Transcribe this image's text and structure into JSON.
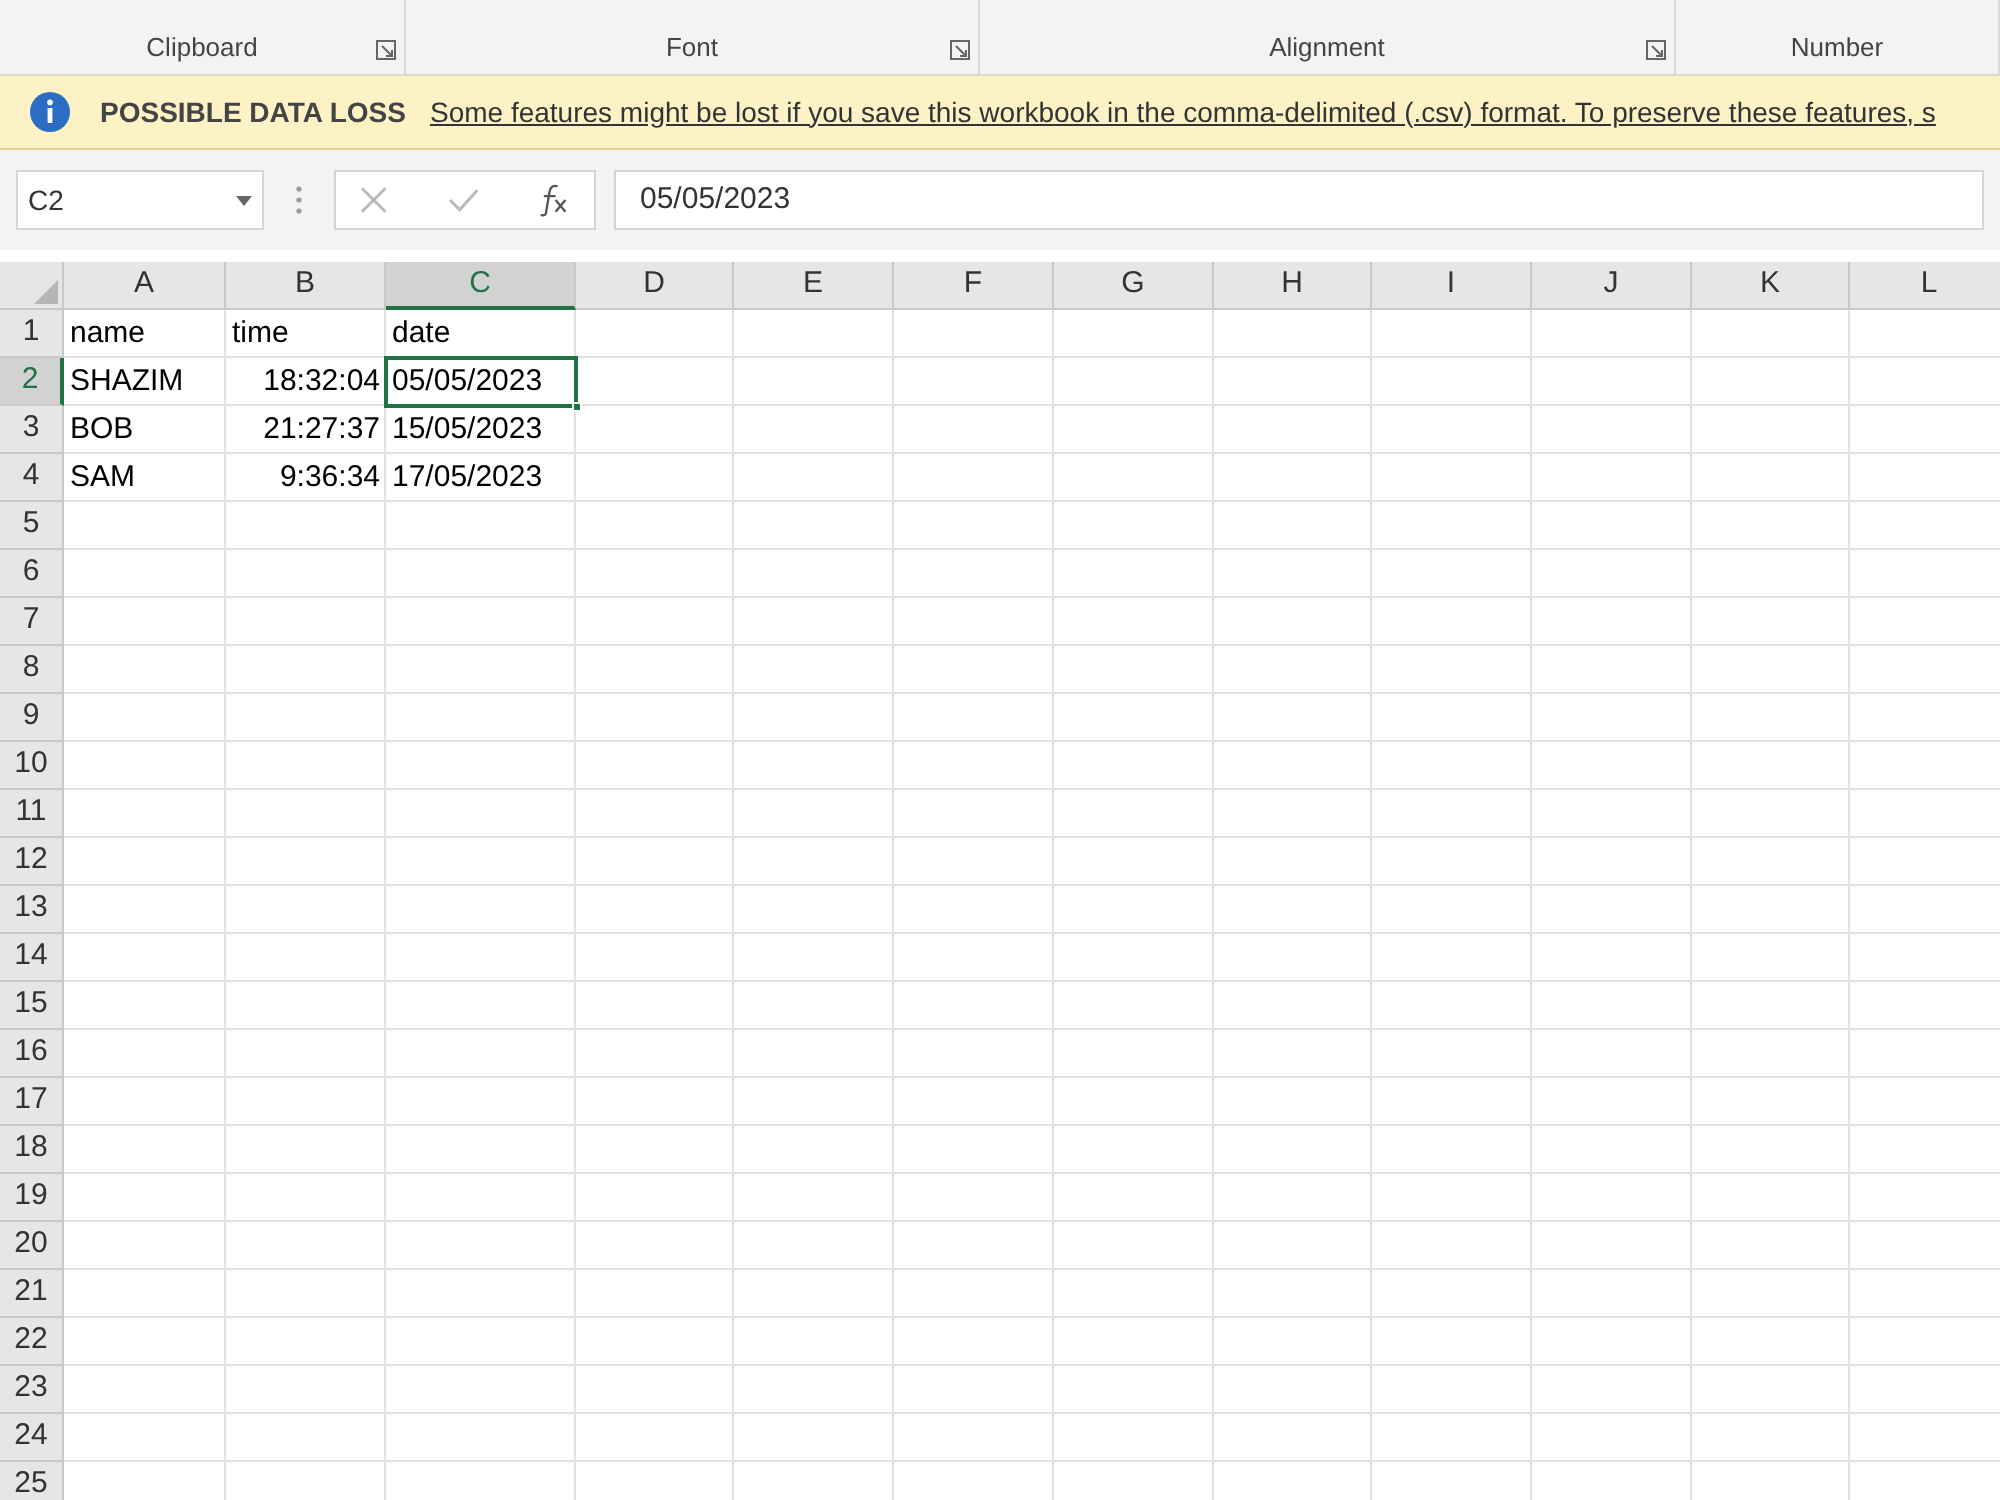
{
  "ribbon": {
    "groups": [
      {
        "label": "Clipboard"
      },
      {
        "label": "Font"
      },
      {
        "label": "Alignment"
      },
      {
        "label": "Number"
      }
    ]
  },
  "message_bar": {
    "title": "POSSIBLE DATA LOSS",
    "link": "Some features might be lost if you save this workbook in the comma-delimited (.csv) format. To preserve these features, s"
  },
  "formula_bar": {
    "name_box": "C2",
    "value": "05/05/2023"
  },
  "columns": [
    {
      "label": "A",
      "selected": false
    },
    {
      "label": "B",
      "selected": false
    },
    {
      "label": "C",
      "selected": true
    },
    {
      "label": "D",
      "selected": false
    },
    {
      "label": "E",
      "selected": false
    },
    {
      "label": "F",
      "selected": false
    },
    {
      "label": "G",
      "selected": false
    },
    {
      "label": "H",
      "selected": false
    },
    {
      "label": "I",
      "selected": false
    },
    {
      "label": "J",
      "selected": false
    },
    {
      "label": "K",
      "selected": false
    },
    {
      "label": "L",
      "selected": false
    }
  ],
  "rows": [
    {
      "number": "1",
      "selected": false,
      "cells": [
        {
          "kind": "text",
          "value": "name",
          "selected": false
        },
        {
          "kind": "text",
          "value": "time",
          "selected": false
        },
        {
          "kind": "text",
          "value": "date",
          "selected": false
        }
      ]
    },
    {
      "number": "2",
      "selected": true,
      "cells": [
        {
          "kind": "text",
          "value": "SHAZIM",
          "selected": false
        },
        {
          "kind": "number",
          "value": "18:32:04",
          "selected": false
        },
        {
          "kind": "text",
          "value": "05/05/2023",
          "selected": true
        }
      ]
    },
    {
      "number": "3",
      "selected": false,
      "cells": [
        {
          "kind": "text",
          "value": "BOB",
          "selected": false
        },
        {
          "kind": "number",
          "value": "21:27:37",
          "selected": false
        },
        {
          "kind": "text",
          "value": "15/05/2023",
          "selected": false
        }
      ]
    },
    {
      "number": "4",
      "selected": false,
      "cells": [
        {
          "kind": "text",
          "value": "SAM",
          "selected": false
        },
        {
          "kind": "number",
          "value": "9:36:34",
          "selected": false
        },
        {
          "kind": "text",
          "value": "17/05/2023",
          "selected": false
        }
      ]
    },
    {
      "number": "5",
      "selected": false,
      "cells": []
    },
    {
      "number": "6",
      "selected": false,
      "cells": []
    },
    {
      "number": "7",
      "selected": false,
      "cells": []
    },
    {
      "number": "8",
      "selected": false,
      "cells": []
    },
    {
      "number": "9",
      "selected": false,
      "cells": []
    },
    {
      "number": "10",
      "selected": false,
      "cells": []
    },
    {
      "number": "11",
      "selected": false,
      "cells": []
    },
    {
      "number": "12",
      "selected": false,
      "cells": []
    },
    {
      "number": "13",
      "selected": false,
      "cells": []
    },
    {
      "number": "14",
      "selected": false,
      "cells": []
    },
    {
      "number": "15",
      "selected": false,
      "cells": []
    },
    {
      "number": "16",
      "selected": false,
      "cells": []
    },
    {
      "number": "17",
      "selected": false,
      "cells": []
    },
    {
      "number": "18",
      "selected": false,
      "cells": []
    },
    {
      "number": "19",
      "selected": false,
      "cells": []
    },
    {
      "number": "20",
      "selected": false,
      "cells": []
    },
    {
      "number": "21",
      "selected": false,
      "cells": []
    },
    {
      "number": "22",
      "selected": false,
      "cells": []
    },
    {
      "number": "23",
      "selected": false,
      "cells": []
    },
    {
      "number": "24",
      "selected": false,
      "cells": []
    },
    {
      "number": "25",
      "selected": false,
      "cells": []
    }
  ]
}
